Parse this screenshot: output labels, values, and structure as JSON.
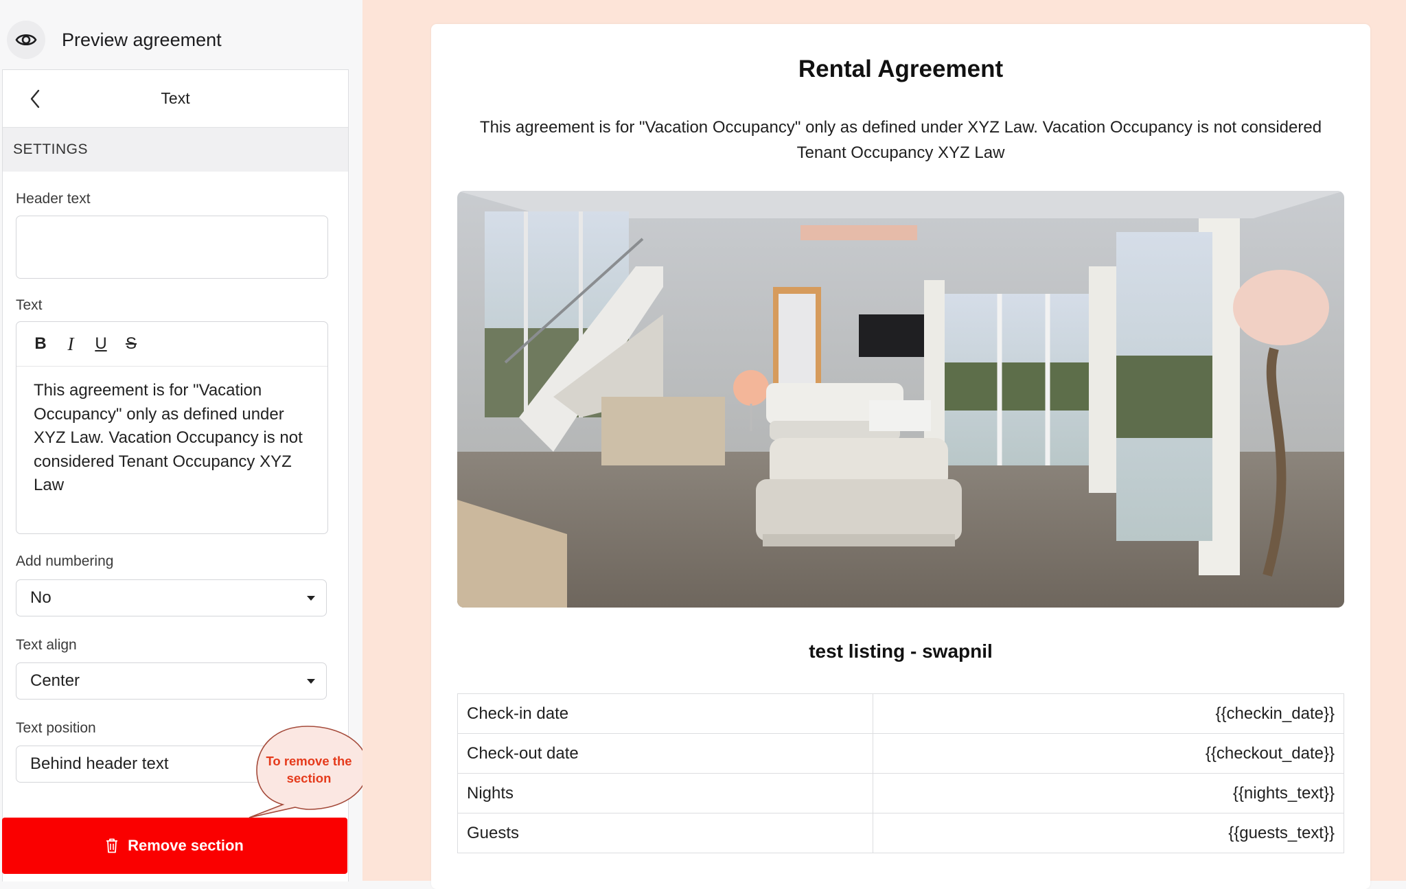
{
  "preview": {
    "label": "Preview agreement",
    "icon": "eye-icon"
  },
  "panel": {
    "title": "Text",
    "settings_label": "SETTINGS",
    "header_text": {
      "label": "Header text",
      "value": "",
      "placeholder": ""
    },
    "text": {
      "label": "Text",
      "toolbar": {
        "bold": "B",
        "italic": "I",
        "underline": "U",
        "strike": "S"
      },
      "content": "This agreement is for \"Vacation Occupancy\" only as defined under XYZ Law. Vacation Occupancy is not considered Tenant Occupancy XYZ Law"
    },
    "add_numbering": {
      "label": "Add numbering",
      "value": "No"
    },
    "text_align": {
      "label": "Text align",
      "value": "Center"
    },
    "text_position": {
      "label": "Text position",
      "value": "Behind header text"
    },
    "remove_button": "Remove section",
    "callout": "To remove the section"
  },
  "colors": {
    "remove": "#fa0000",
    "callout": "#e53a1b",
    "canvas": "#fde4d8"
  },
  "document": {
    "title": "Rental Agreement",
    "intro": "This agreement is for \"Vacation Occupancy\" only as defined under XYZ Law. Vacation Occupancy is not considered Tenant Occupancy XYZ Law",
    "listing_title": "test listing - swapnil",
    "rows": [
      {
        "label": "Check-in date",
        "value": "{{checkin_date}}"
      },
      {
        "label": "Check-out date",
        "value": "{{checkout_date}}"
      },
      {
        "label": "Nights",
        "value": "{{nights_text}}"
      },
      {
        "label": "Guests",
        "value": "{{guests_text}}"
      }
    ]
  }
}
